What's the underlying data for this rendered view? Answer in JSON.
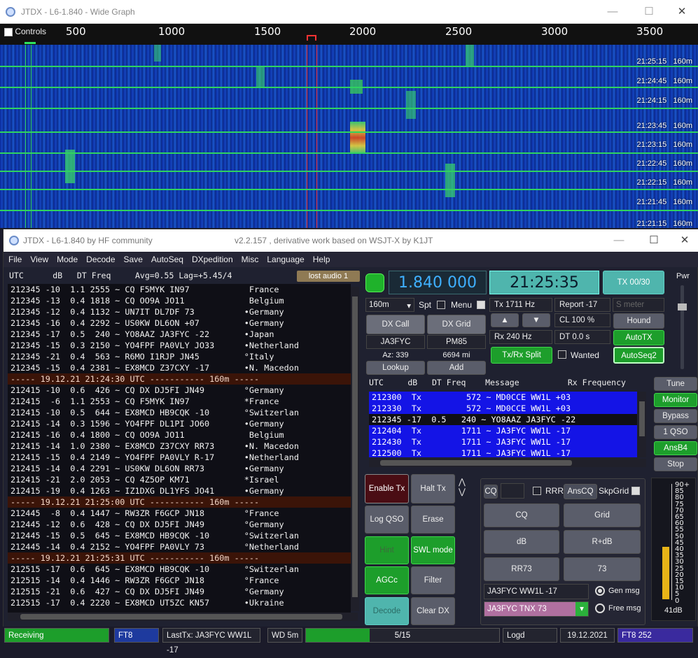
{
  "wide_graph": {
    "title": "JTDX - L6-1.840 - Wide Graph",
    "controls_label": "Controls",
    "scale_ticks": [
      "500",
      "1000",
      "1500",
      "2000",
      "2500",
      "3000",
      "3500"
    ],
    "waterfall_labels": [
      {
        "time": "21:25:15",
        "band": "160m"
      },
      {
        "time": "21:24:45",
        "band": "160m"
      },
      {
        "time": "21:24:15",
        "band": "160m"
      },
      {
        "time": "21:23:45",
        "band": "160m"
      },
      {
        "time": "21:23:15",
        "band": "160m"
      },
      {
        "time": "21:22:45",
        "band": "160m"
      },
      {
        "time": "21:22:15",
        "band": "160m"
      },
      {
        "time": "21:21:45",
        "band": "160m"
      },
      {
        "time": "21:21:15",
        "band": "160m"
      }
    ]
  },
  "main": {
    "title": "JTDX - L6-1.840   by HF community",
    "version": "v2.2.157 , derivative work based on WSJT-X by K1JT",
    "menu": [
      "File",
      "View",
      "Mode",
      "Decode",
      "Save",
      "AutoSeq",
      "DXpedition",
      "Misc",
      "Language",
      "Help"
    ],
    "left_header": "UTC      dB   DT Freq     Avg=0.55 Lag=+5.45/4",
    "lost_audio": "lost audio 1",
    "decodes": [
      {
        "t": "212345 -10  1.1 2555 ~ CQ F5MYK IN97            France"
      },
      {
        "t": "212345 -13  0.4 1818 ~ CQ OO9A JO11             Belgium"
      },
      {
        "t": "212345 -12  0.4 1132 ~ UN7IT DL7DF 73          •Germany"
      },
      {
        "t": "212345 -16  0.4 2292 ~ US0KW DL6ON +07         •Germany"
      },
      {
        "t": "212345 -17  0.5  240 ~ YO8AAZ JA3FYC -22       •Japan"
      },
      {
        "t": "212345 -15  0.3 2150 ~ YO4FPF PA0VLY JO33      •Netherland"
      },
      {
        "t": "212345 -21  0.4  563 ~ R6MO I1RJP JN45         °Italy"
      },
      {
        "t": "212345 -15  0.4 2381 ~ EX8MCD Z37CXY -17       •N. Macedon"
      },
      {
        "t": "----- 19.12.21 21:24:30 UTC ----------- 160m -----",
        "sep": true
      },
      {
        "t": "212415 -10  0.6  426 ~ CQ DX DJ5FI JN49        °Germany"
      },
      {
        "t": "212415  -6  1.1 2553 ~ CQ F5MYK IN97           *France"
      },
      {
        "t": "212415 -10  0.5  644 ~ EX8MCD HB9CQK -10       °Switzerlan"
      },
      {
        "t": "212415 -14  0.3 1596 ~ YO4FPF DL1PI JO60       •Germany"
      },
      {
        "t": "212415 -16  0.4 1800 ~ CQ OO9A JO11             Belgium"
      },
      {
        "t": "212415 -14  1.0 2380 ~ EX8MCD Z37CXY RR73      •N. Macedon"
      },
      {
        "t": "212415 -15  0.4 2149 ~ YO4FPF PA0VLY R-17      •Netherland"
      },
      {
        "t": "212415 -14  0.4 2291 ~ US0KW DL6ON RR73        •Germany"
      },
      {
        "t": "212415 -21  2.0 2053 ~ CQ 4Z5OP KM71           *Israel"
      },
      {
        "t": "212415 -19  0.4 1263 ~ IZ1DXG DL1YFS JO41      •Germany"
      },
      {
        "t": "----- 19.12.21 21:25:00 UTC ----------- 160m -----",
        "sep": true
      },
      {
        "t": "212445  -8  0.4 1447 ~ RW3ZR F6GCP JN18        °France"
      },
      {
        "t": "212445 -12  0.6  428 ~ CQ DX DJ5FI JN49        °Germany"
      },
      {
        "t": "212445 -15  0.5  645 ~ EX8MCD HB9CQK -10       °Switzerlan"
      },
      {
        "t": "212445 -14  0.4 2152 ~ YO4FPF PA0VLY 73        °Netherland"
      },
      {
        "t": "----- 19.12.21 21:25:31 UTC ----------- 160m -----",
        "sep": true
      },
      {
        "t": "212515 -17  0.6  645 ~ EX8MCD HB9CQK -10       °Switzerlan"
      },
      {
        "t": "212515 -14  0.4 1446 ~ RW3ZR F6GCP JN18        °France"
      },
      {
        "t": "212515 -21  0.6  427 ~ CQ DX DJ5FI JN49        °Germany"
      },
      {
        "t": "212515 -17  0.4 2220 ~ EX8MCD UT5ZC KN57       •Ukraine"
      }
    ],
    "freq_display": "1.840 000",
    "clock": "21:25:35",
    "tx_counter": "TX 00/30",
    "band_select": "160m",
    "spt_label": "Spt",
    "menu_label": "Menu",
    "tx_freq": "Tx  1711  Hz",
    "report": "Report -17",
    "smeter_placeholder": "S meter",
    "dx_call_btn": "DX Call",
    "dx_grid_btn": "DX Grid",
    "dx_call_val": "JA3FYC",
    "dx_grid_val": "PM85",
    "az": "Az: 339",
    "dist": "6694 mi",
    "lookup": "Lookup",
    "add": "Add",
    "up_arrow": "▲",
    "down_arrow": "▼",
    "cl": "CL  100 %",
    "hound": "Hound",
    "rx_freq": "Rx  240  Hz",
    "dt": "DT 0.0 s",
    "autotx": "AutoTX",
    "txrx_split": "Tx/Rx Split",
    "wanted": "Wanted",
    "autoseq2": "AutoSeq2",
    "rx_header": "UTC     dB   DT Freq    Message          Rx Frequency",
    "rx_rows": [
      {
        "t": "212300  Tx         572 ~ MD0CCE WW1L +03",
        "blue": true
      },
      {
        "t": "212330  Tx         572 ~ MD0CCE WW1L +03",
        "blue": true
      },
      {
        "t": "212345 -17  0.5   240 ~ YO8AAZ JA3FYC -22",
        "blue": false
      },
      {
        "t": "212404  Tx        1711 ~ JA3FYC WW1L -17",
        "blue": true
      },
      {
        "t": "212430  Tx        1711 ~ JA3FYC WW1L -17",
        "blue": true
      },
      {
        "t": "212500  Tx        1711 ~ JA3FYC WW1L -17",
        "blue": true
      }
    ],
    "side_buttons": [
      "Tune",
      "Monitor",
      "Bypass",
      "1 QSO",
      "AnsB4",
      "Stop"
    ],
    "pwr_label": "Pwr",
    "enable_tx": "Enable Tx",
    "halt_tx": "Halt Tx",
    "log_qso": "Log QSO",
    "erase": "Erase",
    "hint": "Hint",
    "swl_mode": "SWL mode",
    "agcc": "AGCc",
    "filter": "Filter",
    "decode": "Decode",
    "clear_dx": "Clear DX",
    "cq_label": "CQ",
    "rrr_label": "RRR",
    "anscq": "AnsCQ",
    "skpgrid": "SkpGrid",
    "msg_buttons": [
      "CQ",
      "Grid",
      "dB",
      "R+dB",
      "RR73",
      "73"
    ],
    "gen_msg_field": "JA3FYC WW1L -17",
    "free_msg_field": "JA3FYC TNX 73",
    "gen_msg": "Gen msg",
    "free_msg": "Free msg",
    "meter_scale": [
      "90+",
      "85",
      "80",
      "75",
      "70",
      "65",
      "60",
      "55",
      "50",
      "45",
      "40",
      "35",
      "30",
      "25",
      "20",
      "15",
      "10",
      "5",
      "0"
    ],
    "meter_db": "41dB",
    "meter_level_fraction": 0.45
  },
  "status": {
    "receiving": "Receiving",
    "mode": "FT8",
    "last_tx": "LastTx: JA3FYC WW1L -17",
    "wd": "WD 5m",
    "progress": "5/15",
    "progress_fraction": 0.33,
    "logd": "Logd",
    "date": "19.12.2021",
    "mode_right": "FT8  252"
  },
  "colors": {
    "accent_green": "#1d9e2b",
    "teal": "#4fb5ad",
    "tx_blue": "#1414e6",
    "sep_bg": "#3b1408"
  }
}
